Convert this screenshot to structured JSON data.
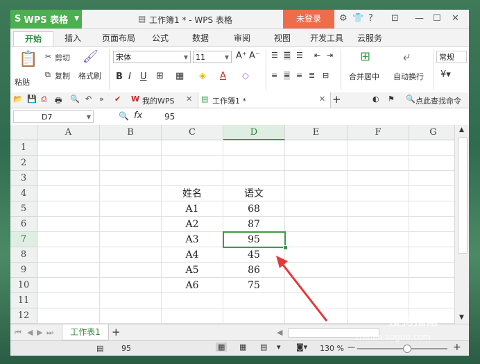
{
  "app": {
    "name": "WPS 表格",
    "doc_title": "工作簿1 * - WPS 表格",
    "login": "未登录"
  },
  "tabs": [
    "开始",
    "插入",
    "页面布局",
    "公式",
    "数据",
    "审阅",
    "视图",
    "开发工具",
    "云服务"
  ],
  "ribbon": {
    "paste": "粘贴",
    "cut": "剪切",
    "copy": "复制",
    "format_painter": "格式刷",
    "font": "宋体",
    "font_size": "11",
    "merge_center": "合并居中",
    "wrap_text": "自动换行",
    "number_format": "常规"
  },
  "docbar": {
    "my_wps": "我的WPS",
    "workbook_tab": "工作簿1 *",
    "search": "点此查找命令"
  },
  "formula": {
    "name_box": "D7",
    "fx": "fx",
    "value": "95"
  },
  "columns": [
    "A",
    "B",
    "C",
    "D",
    "E",
    "F",
    "G"
  ],
  "rows": [
    "1",
    "2",
    "3",
    "4",
    "5",
    "6",
    "7",
    "8",
    "9",
    "10",
    "11",
    "12"
  ],
  "table": {
    "header": {
      "name": "姓名",
      "chinese": "语文"
    },
    "records": [
      {
        "name": "A1",
        "score": "68"
      },
      {
        "name": "A2",
        "score": "87"
      },
      {
        "name": "A3",
        "score": "95"
      },
      {
        "name": "A4",
        "score": "45"
      },
      {
        "name": "A5",
        "score": "86"
      },
      {
        "name": "A6",
        "score": "75"
      }
    ]
  },
  "sheet": {
    "name": "工作表1"
  },
  "status": {
    "value": "95",
    "zoom": "130 %"
  },
  "watermark": {
    "brand": "搜狗指南",
    "url": "zhinan.sogou.com"
  },
  "colors": {
    "accent": "#4caf50",
    "login": "#ef6c4a",
    "selection": "#3a9a48"
  }
}
